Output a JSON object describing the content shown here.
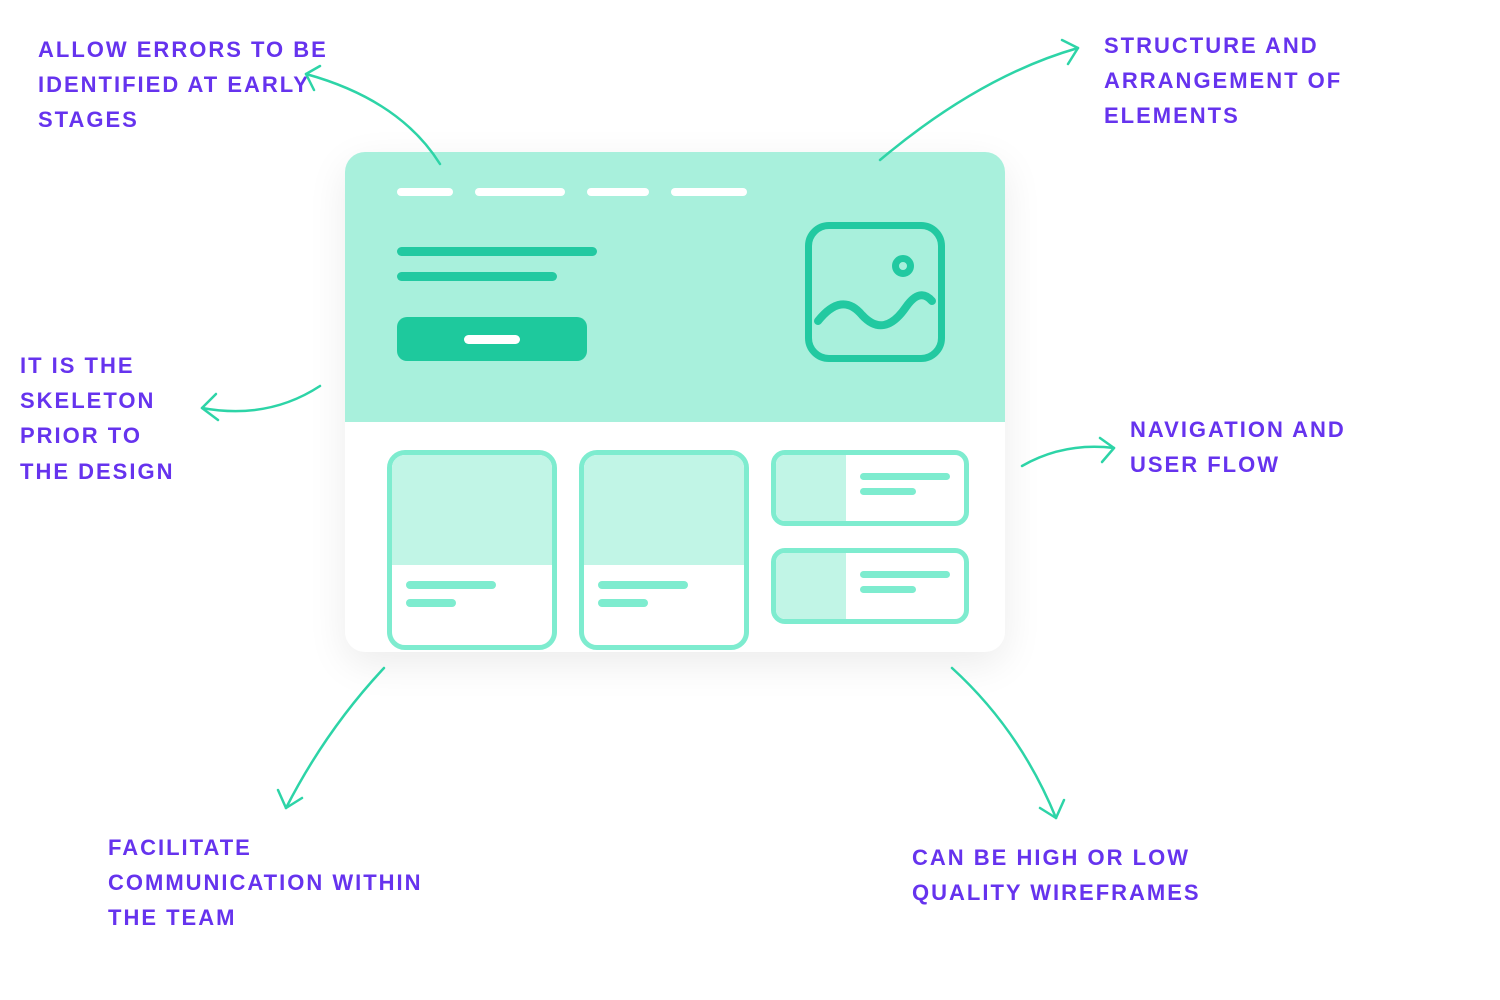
{
  "labels": {
    "top_left": "ALLOW ERRORS TO BE IDENTIFIED AT EARLY STAGES",
    "top_right": "STRUCTURE AND ARRANGEMENT OF ELEMENTS",
    "mid_left": "IT IS THE SKELETON PRIOR TO THE DESIGN",
    "mid_right": "NAVIGATION AND USER FLOW",
    "bottom_left": "FACILITATE COMMUNICATION WITHIN THE TEAM",
    "bottom_right": "CAN BE HIGH OR LOW QUALITY WIREFRAMES"
  },
  "colors": {
    "accent": "#6633ee",
    "mint": "#a8f0dc",
    "teal": "#22c9a1",
    "arrow": "#2dd4a7"
  }
}
